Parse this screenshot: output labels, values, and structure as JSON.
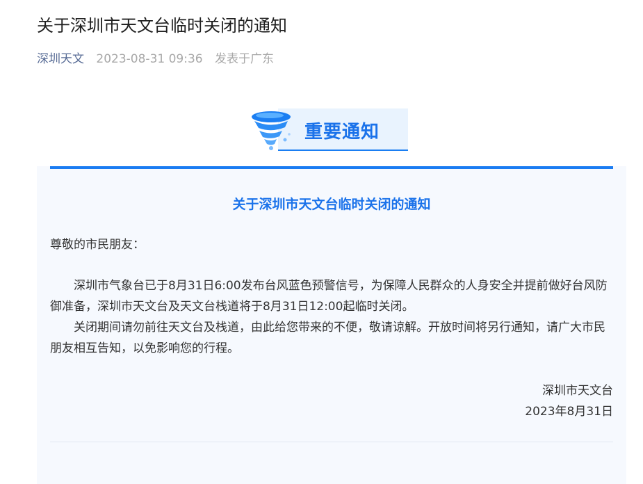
{
  "article": {
    "title": "关于深圳市天文台临时关闭的通知",
    "account_name": "深圳天文",
    "publish_time": "2023-08-31 09:36",
    "location": "发表于广东"
  },
  "banner": {
    "label": "重要通知",
    "icon": "tornado-icon",
    "accent_color": "#1a7cf2"
  },
  "notice": {
    "title": "关于深圳市天文台临时关闭的通知",
    "salutation": "尊敬的市民朋友：",
    "paragraphs": [
      "深圳市气象台已于8月31日6:00发布台风蓝色预警信号，为保障人民群众的人身安全并提前做好台风防御准备，深圳市天文台及天文台栈道将于8月31日12:00起临时关闭。",
      "关闭期间请勿前往天文台及栈道，由此给您带来的不便，敬请谅解。开放时间将另行通知，请广大市民朋友相互告知，以免影响您的行程。"
    ],
    "signature": "深圳市天文台",
    "date": "2023年8月31日"
  }
}
